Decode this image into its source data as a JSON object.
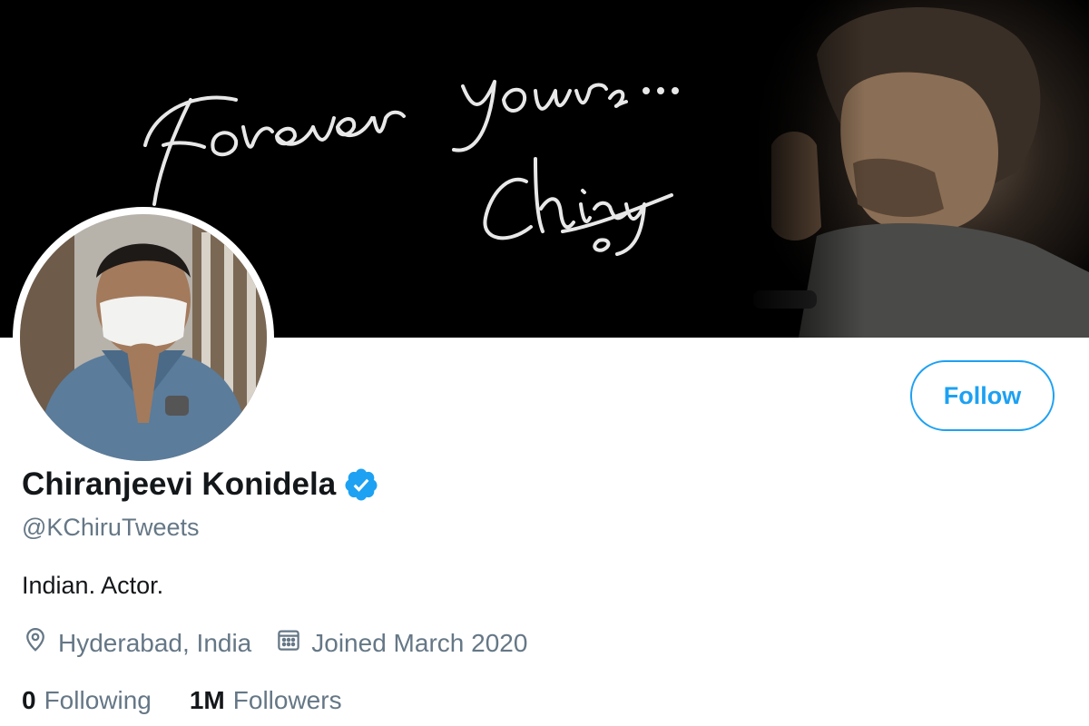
{
  "banner": {
    "signature_text": "Forever Yours...",
    "signature_name": "Chiru"
  },
  "profile": {
    "name": "Chiranjeevi Konidela",
    "handle": "@KChiruTweets",
    "bio": "Indian. Actor.",
    "location": "Hyderabad, India",
    "joined": "Joined March 2020",
    "verified": true
  },
  "actions": {
    "follow_label": "Follow"
  },
  "stats": {
    "following_count": "0",
    "following_label": "Following",
    "followers_count": "1M",
    "followers_label": "Followers"
  },
  "icons": {
    "verified": "verified-badge-icon",
    "location": "location-pin-icon",
    "calendar": "calendar-icon"
  },
  "colors": {
    "accent": "#1da1f2",
    "text_primary": "#14171a",
    "text_secondary": "#657786",
    "banner_bg": "#000000"
  }
}
